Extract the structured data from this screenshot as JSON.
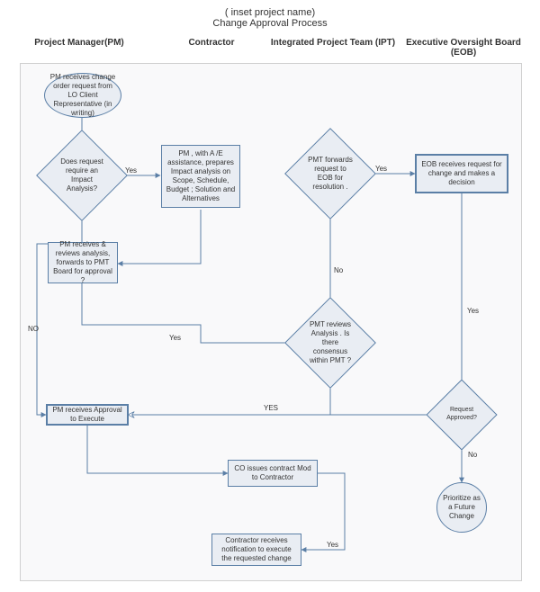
{
  "title_line1": "(   inset project name)",
  "title_line2": "Change Approval Process",
  "lanes": {
    "pm": "Project Manager(PM)",
    "contractor": "Contractor",
    "ipt": "Integrated Project Team (IPT)",
    "eob": "Executive Oversight Board (EOB)"
  },
  "nodes": {
    "start": "PM receives change order request from LO Client Representative (in writing)",
    "d_impact": "Does request require an Impact Analysis?",
    "impact_prep": "PM , with A /E assistance, prepares Impact analysis on Scope, Schedule, Budget ; Solution and Alternatives",
    "d_fwd_eob": "PMT forwards request to EOB for resolution .",
    "eob_review": "EOB receives request for change and makes a decision",
    "pm_reviews": "PM receives & reviews analysis, forwards to PMT Board for approval ?",
    "d_consensus": "PMT reviews Analysis . Is there consensus within PMT ?",
    "approve_exec": "PM receives Approval to Execute",
    "co_mod": "CO issues contract Mod to Contractor",
    "d_approved": "Request Approved?",
    "future": "Prioritize as a Future Change",
    "notify": "Contractor receives notification to execute the requested change"
  },
  "edges": {
    "no": "No",
    "yes": "Yes",
    "NO": "NO",
    "YES": "YES"
  }
}
